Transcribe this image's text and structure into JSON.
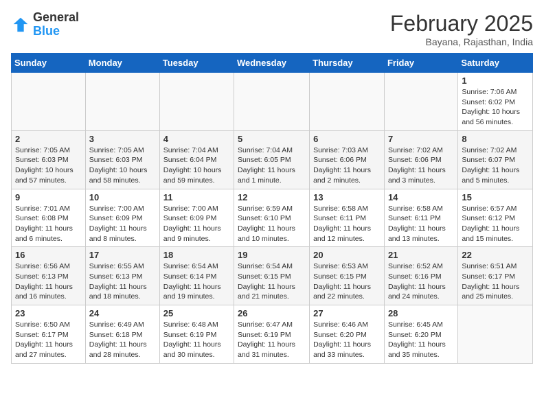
{
  "logo": {
    "general": "General",
    "blue": "Blue"
  },
  "title": "February 2025",
  "subtitle": "Bayana, Rajasthan, India",
  "weekdays": [
    "Sunday",
    "Monday",
    "Tuesday",
    "Wednesday",
    "Thursday",
    "Friday",
    "Saturday"
  ],
  "weeks": [
    [
      {
        "day": "",
        "info": ""
      },
      {
        "day": "",
        "info": ""
      },
      {
        "day": "",
        "info": ""
      },
      {
        "day": "",
        "info": ""
      },
      {
        "day": "",
        "info": ""
      },
      {
        "day": "",
        "info": ""
      },
      {
        "day": "1",
        "info": "Sunrise: 7:06 AM\nSunset: 6:02 PM\nDaylight: 10 hours and 56 minutes."
      }
    ],
    [
      {
        "day": "2",
        "info": "Sunrise: 7:05 AM\nSunset: 6:03 PM\nDaylight: 10 hours and 57 minutes."
      },
      {
        "day": "3",
        "info": "Sunrise: 7:05 AM\nSunset: 6:03 PM\nDaylight: 10 hours and 58 minutes."
      },
      {
        "day": "4",
        "info": "Sunrise: 7:04 AM\nSunset: 6:04 PM\nDaylight: 10 hours and 59 minutes."
      },
      {
        "day": "5",
        "info": "Sunrise: 7:04 AM\nSunset: 6:05 PM\nDaylight: 11 hours and 1 minute."
      },
      {
        "day": "6",
        "info": "Sunrise: 7:03 AM\nSunset: 6:06 PM\nDaylight: 11 hours and 2 minutes."
      },
      {
        "day": "7",
        "info": "Sunrise: 7:02 AM\nSunset: 6:06 PM\nDaylight: 11 hours and 3 minutes."
      },
      {
        "day": "8",
        "info": "Sunrise: 7:02 AM\nSunset: 6:07 PM\nDaylight: 11 hours and 5 minutes."
      }
    ],
    [
      {
        "day": "9",
        "info": "Sunrise: 7:01 AM\nSunset: 6:08 PM\nDaylight: 11 hours and 6 minutes."
      },
      {
        "day": "10",
        "info": "Sunrise: 7:00 AM\nSunset: 6:09 PM\nDaylight: 11 hours and 8 minutes."
      },
      {
        "day": "11",
        "info": "Sunrise: 7:00 AM\nSunset: 6:09 PM\nDaylight: 11 hours and 9 minutes."
      },
      {
        "day": "12",
        "info": "Sunrise: 6:59 AM\nSunset: 6:10 PM\nDaylight: 11 hours and 10 minutes."
      },
      {
        "day": "13",
        "info": "Sunrise: 6:58 AM\nSunset: 6:11 PM\nDaylight: 11 hours and 12 minutes."
      },
      {
        "day": "14",
        "info": "Sunrise: 6:58 AM\nSunset: 6:11 PM\nDaylight: 11 hours and 13 minutes."
      },
      {
        "day": "15",
        "info": "Sunrise: 6:57 AM\nSunset: 6:12 PM\nDaylight: 11 hours and 15 minutes."
      }
    ],
    [
      {
        "day": "16",
        "info": "Sunrise: 6:56 AM\nSunset: 6:13 PM\nDaylight: 11 hours and 16 minutes."
      },
      {
        "day": "17",
        "info": "Sunrise: 6:55 AM\nSunset: 6:13 PM\nDaylight: 11 hours and 18 minutes."
      },
      {
        "day": "18",
        "info": "Sunrise: 6:54 AM\nSunset: 6:14 PM\nDaylight: 11 hours and 19 minutes."
      },
      {
        "day": "19",
        "info": "Sunrise: 6:54 AM\nSunset: 6:15 PM\nDaylight: 11 hours and 21 minutes."
      },
      {
        "day": "20",
        "info": "Sunrise: 6:53 AM\nSunset: 6:15 PM\nDaylight: 11 hours and 22 minutes."
      },
      {
        "day": "21",
        "info": "Sunrise: 6:52 AM\nSunset: 6:16 PM\nDaylight: 11 hours and 24 minutes."
      },
      {
        "day": "22",
        "info": "Sunrise: 6:51 AM\nSunset: 6:17 PM\nDaylight: 11 hours and 25 minutes."
      }
    ],
    [
      {
        "day": "23",
        "info": "Sunrise: 6:50 AM\nSunset: 6:17 PM\nDaylight: 11 hours and 27 minutes."
      },
      {
        "day": "24",
        "info": "Sunrise: 6:49 AM\nSunset: 6:18 PM\nDaylight: 11 hours and 28 minutes."
      },
      {
        "day": "25",
        "info": "Sunrise: 6:48 AM\nSunset: 6:19 PM\nDaylight: 11 hours and 30 minutes."
      },
      {
        "day": "26",
        "info": "Sunrise: 6:47 AM\nSunset: 6:19 PM\nDaylight: 11 hours and 31 minutes."
      },
      {
        "day": "27",
        "info": "Sunrise: 6:46 AM\nSunset: 6:20 PM\nDaylight: 11 hours and 33 minutes."
      },
      {
        "day": "28",
        "info": "Sunrise: 6:45 AM\nSunset: 6:20 PM\nDaylight: 11 hours and 35 minutes."
      },
      {
        "day": "",
        "info": ""
      }
    ]
  ]
}
